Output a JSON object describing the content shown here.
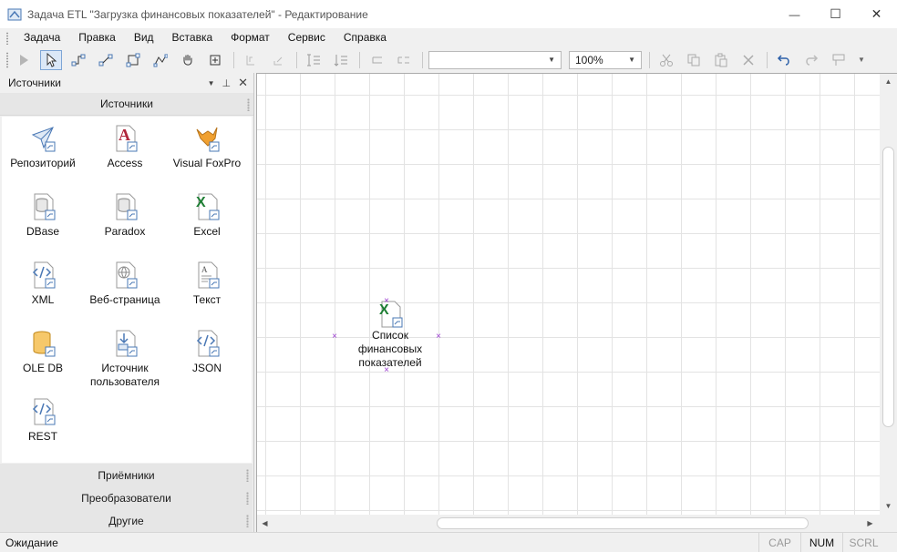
{
  "window": {
    "title": "Задача ETL \"Загрузка финансовых показателей\" - Редактирование",
    "minimize_glyph": "—",
    "maximize_glyph": "☐",
    "close_glyph": "✕"
  },
  "menu": [
    "Задача",
    "Правка",
    "Вид",
    "Вставка",
    "Формат",
    "Сервис",
    "Справка"
  ],
  "toolbar": {
    "font_combo_value": "",
    "zoom_value": "100%"
  },
  "panel": {
    "header": "Источники",
    "section_title": "Источники",
    "sources": [
      {
        "label": "Репозиторий",
        "icon": "repository-icon"
      },
      {
        "label": "Access",
        "icon": "access-icon"
      },
      {
        "label": "Visual FoxPro",
        "icon": "foxpro-icon"
      },
      {
        "label": "DBase",
        "icon": "dbase-icon"
      },
      {
        "label": "Paradox",
        "icon": "paradox-icon"
      },
      {
        "label": "Excel",
        "icon": "excel-icon"
      },
      {
        "label": "XML",
        "icon": "xml-icon"
      },
      {
        "label": "Веб-страница",
        "icon": "web-page-icon"
      },
      {
        "label": "Текст",
        "icon": "text-icon"
      },
      {
        "label": "OLE DB",
        "icon": "oledb-icon"
      },
      {
        "label": "Источник\nпользователя",
        "label_line1": "Источник",
        "label_line2": "пользователя",
        "icon": "user-source-icon"
      },
      {
        "label": "JSON",
        "icon": "json-icon"
      },
      {
        "label": "REST",
        "icon": "rest-icon"
      }
    ],
    "bottom_sections": [
      "Приёмники",
      "Преобразователи",
      "Другие"
    ]
  },
  "canvas": {
    "node": {
      "icon": "excel-icon",
      "line1": "Список",
      "line2": "финансовых",
      "line3": "показателей"
    }
  },
  "status": {
    "text": "Ожидание",
    "indicators": [
      {
        "label": "CAP",
        "active": false
      },
      {
        "label": "NUM",
        "active": true
      },
      {
        "label": "SCRL",
        "active": false
      }
    ]
  },
  "colors": {
    "excel_green": "#1e7e34",
    "access_red": "#b0263b",
    "handle_purple": "#9b3dd0",
    "accent_blue": "#4a78b5"
  }
}
